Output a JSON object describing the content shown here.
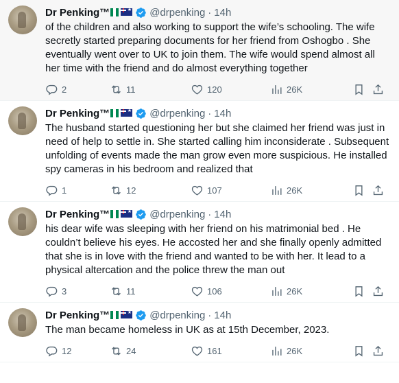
{
  "author": {
    "name": "Dr Penking™",
    "handle": "@drpenking",
    "time": "14h",
    "dot": "·"
  },
  "colors": {
    "verified": "#1d9bf0",
    "nigeria_green": "#008751",
    "text": "#0f1419",
    "muted": "#536471"
  },
  "tweets": [
    {
      "text": "of the children and also working to support the wife’s schooling. The wife secretly started preparing documents for her friend from Oshogbo . She eventually went over to UK to join them. The wife would spend almost all her time with the friend and do almost everything together",
      "replies": "2",
      "reposts": "11",
      "likes": "120",
      "views": "26K"
    },
    {
      "text": "The husband started questioning her but she claimed her friend was just in need of help to settle in. She started calling him inconsiderate . Subsequent unfolding of events made the man grow even more suspicious. He installed spy cameras in his bedroom and realized that",
      "replies": "1",
      "reposts": "12",
      "likes": "107",
      "views": "26K"
    },
    {
      "text": "his dear wife was sleeping with her friend on his matrimonial bed . He couldn’t believe his eyes. He accosted her and she finally openly admitted that she is in love with the friend and wanted to be with her. It lead to a physical altercation and the police threw the man out",
      "replies": "3",
      "reposts": "11",
      "likes": "106",
      "views": "26K"
    },
    {
      "text": "The man became homeless in UK as at 15th December, 2023.",
      "replies": "12",
      "reposts": "24",
      "likes": "161",
      "views": "26K"
    }
  ]
}
